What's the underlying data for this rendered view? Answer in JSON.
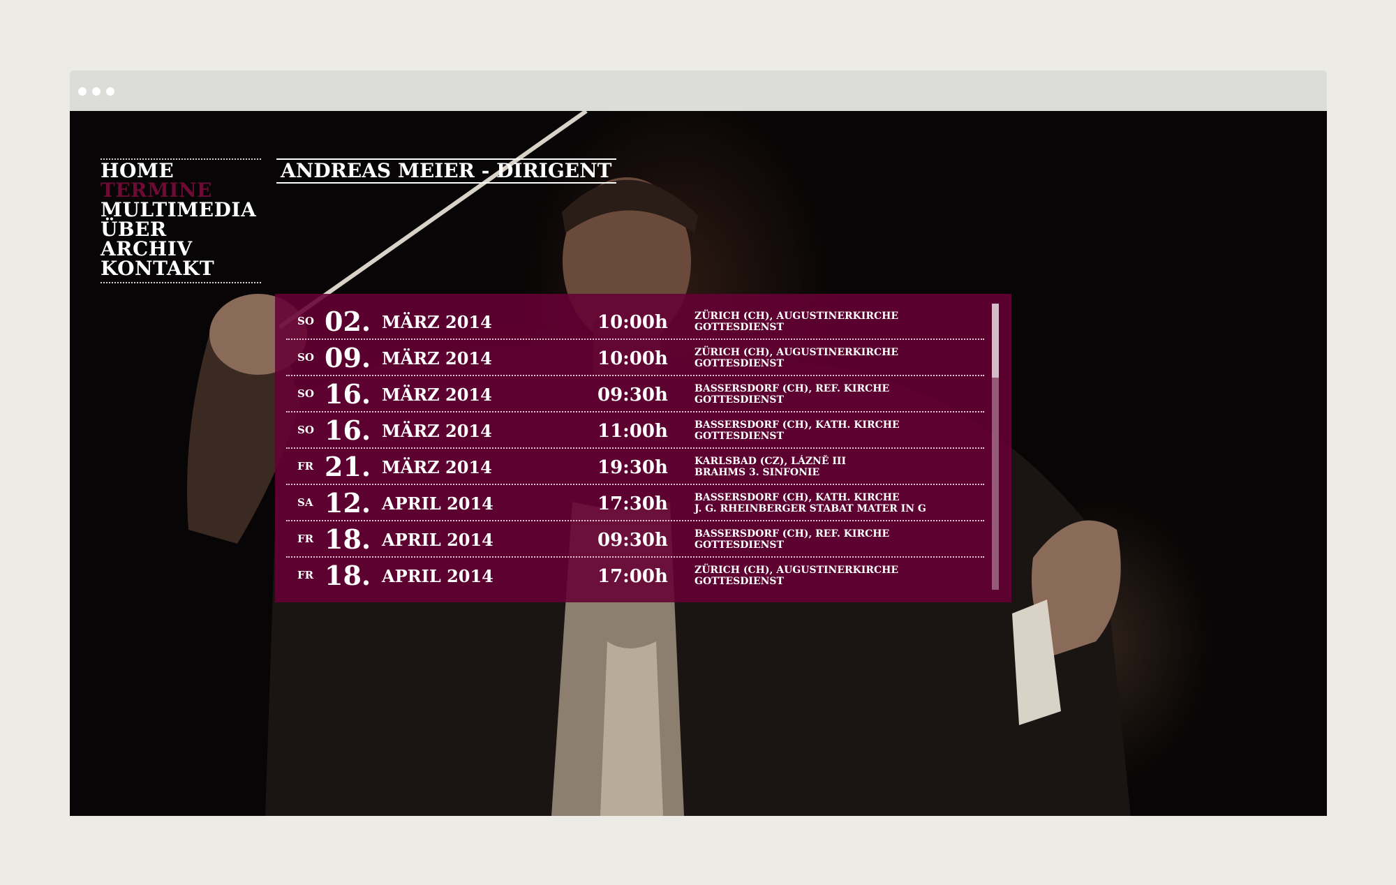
{
  "site": {
    "title": "ANDREAS MEIER - DIRIGENT"
  },
  "nav": {
    "items": [
      {
        "label": "HOME",
        "active": false
      },
      {
        "label": "TERMINE",
        "active": true
      },
      {
        "label": "MULTIMEDIA",
        "active": false
      },
      {
        "label": "ÜBER",
        "active": false
      },
      {
        "label": "ARCHIV",
        "active": false
      },
      {
        "label": "KONTAKT",
        "active": false
      }
    ]
  },
  "events": [
    {
      "weekday": "SO",
      "day": "02.",
      "month_year": "MÄRZ 2014",
      "time": "10:00h",
      "place": "ZÜRICH (CH), AUGUSTINERKIRCHE",
      "description": "GOTTESDIENST"
    },
    {
      "weekday": "SO",
      "day": "09.",
      "month_year": "MÄRZ 2014",
      "time": "10:00h",
      "place": "ZÜRICH (CH), AUGUSTINERKIRCHE",
      "description": "GOTTESDIENST"
    },
    {
      "weekday": "SO",
      "day": "16.",
      "month_year": "MÄRZ 2014",
      "time": "09:30h",
      "place": "BASSERSDORF (CH), REF. KIRCHE",
      "description": "GOTTESDIENST"
    },
    {
      "weekday": "SO",
      "day": "16.",
      "month_year": "MÄRZ 2014",
      "time": "11:00h",
      "place": "BASSERSDORF (CH), KATH. KIRCHE",
      "description": "GOTTESDIENST"
    },
    {
      "weekday": "FR",
      "day": "21.",
      "month_year": "MÄRZ 2014",
      "time": "19:30h",
      "place": "KARLSBAD (CZ), LÁZNĚ III",
      "description": "BRAHMS 3. SINFONIE"
    },
    {
      "weekday": "SA",
      "day": "12.",
      "month_year": "APRIL 2014",
      "time": "17:30h",
      "place": "BASSERSDORF (CH), KATH. KIRCHE",
      "description": "J. G. RHEINBERGER STABAT MATER IN G"
    },
    {
      "weekday": "FR",
      "day": "18.",
      "month_year": "APRIL 2014",
      "time": "09:30h",
      "place": "BASSERSDORF (CH), REF. KIRCHE",
      "description": "GOTTESDIENST"
    },
    {
      "weekday": "FR",
      "day": "18.",
      "month_year": "APRIL 2014",
      "time": "17:00h",
      "place": "ZÜRICH (CH), AUGUSTINERKIRCHE",
      "description": "GOTTESDIENST"
    }
  ],
  "colors": {
    "accent": "#6e0b35",
    "panel": "#660034",
    "page_bg": "#ecebe6",
    "chrome": "#dcdcd9"
  }
}
